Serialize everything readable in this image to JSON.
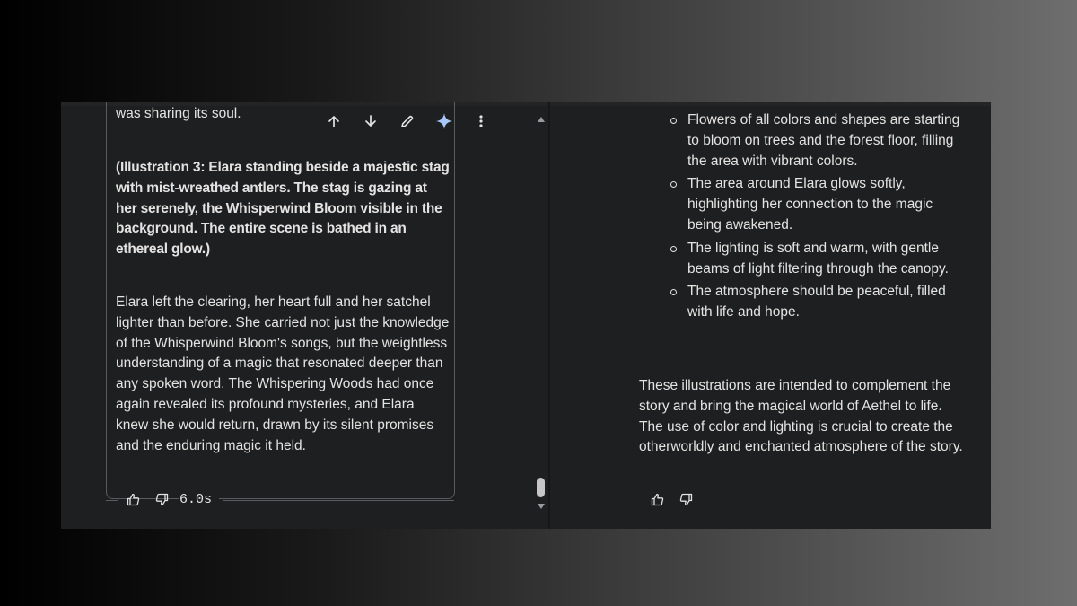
{
  "left": {
    "first_line": "was sharing its soul.",
    "illustration": "(Illustration 3: Elara standing beside a majestic stag with mist-wreathed antlers. The stag is gazing at her serenely, the Whisperwind Bloom visible in the background. The entire scene is bathed in an ethereal glow.)",
    "paragraph": "Elara left the clearing, her heart full and her satchel lighter than before. She carried not just the knowledge of the Whisperwind Bloom's songs, but the weightless understanding of a magic that resonated deeper than any spoken word. The Whispering Woods had once again revealed its profound mysteries, and Elara knew she would return, drawn by its silent promises and the enduring magic it held.",
    "toolbar_icons": [
      "arrow-up-icon",
      "arrow-down-icon",
      "pencil-icon",
      "sparkle-icon",
      "more-vert-icon"
    ],
    "timing": "6.0s"
  },
  "right": {
    "bullets": [
      "Flowers of all colors and shapes are starting to bloom on trees and the forest floor, filling the area with vibrant colors.",
      "The area around Elara glows softly, highlighting her connection to the magic being awakened.",
      "The lighting is soft and warm, with gentle beams of light filtering through the canopy.",
      "The atmosphere should be peaceful, filled with life and hope."
    ],
    "closing": "These illustrations are intended to complement the story and bring the magical world of Aethel to life. The use of color and lighting is crucial to create the otherworldly and enchanted atmosphere of the story."
  },
  "colors": {
    "panel_bg": "#1e1f20",
    "text": "#e3e3e3",
    "sparkle_accent": "#a8c7fa",
    "border": "#5a5b5e"
  }
}
